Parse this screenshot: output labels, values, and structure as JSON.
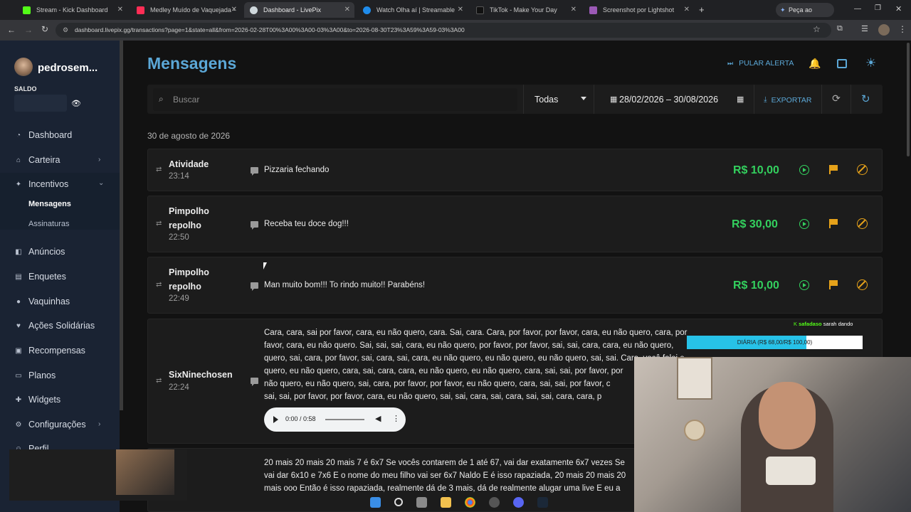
{
  "browser": {
    "tabs": [
      {
        "title": "Stream - Kick Dashboard",
        "color": "#53fc18"
      },
      {
        "title": "Medley Muído de Vaquejada - ",
        "color": "#ff2d55"
      },
      {
        "title": "Dashboard - LivePix",
        "color": "#cfd8dc"
      },
      {
        "title": "Watch Olha aí | Streamable",
        "color": "#1f8ceb"
      },
      {
        "title": "TikTok - Make Your Day",
        "color": "#111111"
      },
      {
        "title": "Screenshot por Lightshot",
        "color": "#9b59b6"
      }
    ],
    "new_tab": "+",
    "gemini": "Peça ao Gemini",
    "url": "dashboard.livepix.gg/transactions?page=1&state=all&from=2026-02-28T00%3A00%3A00-03%3A00&to=2026-08-30T23%3A59%3A59-03%3A00"
  },
  "sidebar": {
    "username": "pedrosem...",
    "saldo_label": "SALDO",
    "items": [
      {
        "label": "Dashboard",
        "icon": "speedometer-icon"
      },
      {
        "label": "Carteira",
        "icon": "bank-icon",
        "chevron": "›"
      },
      {
        "label": "Incentivos",
        "icon": "sparkle-icon",
        "chevron": "⌄"
      },
      {
        "label": "Anúncios",
        "icon": "megaphone-icon"
      },
      {
        "label": "Enquetes",
        "icon": "chart-icon"
      },
      {
        "label": "Vaquinhas",
        "icon": "piggy-icon"
      },
      {
        "label": "Ações Solidárias",
        "icon": "heart-hand-icon"
      },
      {
        "label": "Recompensas",
        "icon": "gift-icon"
      },
      {
        "label": "Planos",
        "icon": "credit-card-icon"
      },
      {
        "label": "Widgets",
        "icon": "puzzle-icon"
      },
      {
        "label": "Configurações",
        "icon": "gear-icon",
        "chevron": "›"
      },
      {
        "label": "Perfil",
        "icon": "user-icon"
      }
    ],
    "subitems": [
      "Mensagens",
      "Assinaturas"
    ]
  },
  "header": {
    "title": "Mensagens",
    "skip_alert": "PULAR ALERTA"
  },
  "filters": {
    "search_placeholder": "Buscar",
    "state": "Todas",
    "date_range": "28/02/2026 – 30/08/2026",
    "export": "EXPORTAR"
  },
  "date_header": "30 de agosto de 2026",
  "transactions": [
    {
      "name": "Atividade",
      "time": "23:14",
      "message": "Pizzaria fechando",
      "amount": "R$ 10,00"
    },
    {
      "name": "Pimpolho repolho",
      "time": "22:50",
      "message": "Receba teu doce dog!!!",
      "amount": "R$ 30,00"
    },
    {
      "name": "Pimpolho repolho",
      "time": "22:49",
      "message": "Man muito bom!!! To rindo muito!! Parabéns!",
      "amount": "R$ 10,00"
    },
    {
      "name": "SixNinechosen",
      "time": "22:24",
      "lines": [
        "Cara, cara, sai por favor, cara, eu não quero, cara. Sai, cara. Cara, por favor, por favor, cara, eu não quero, cara, por",
        "favor, cara, eu não quero. Sai, sai, sai, cara, eu não quero, por favor, por favor, sai, sai, cara, cara, eu não quero,",
        "quero, sai, cara, por favor, sai, cara, sai, cara, eu não quero, eu não quero, eu não quero, sai, sai. Cara, você falei e",
        "quero, eu não quero, cara, sai, cara, cara, eu não quero, eu não quero, cara, sai, sai, por favor, por",
        "não quero, eu não quero, sai, cara, por favor, por favor, eu não quero, cara, sai, sai, por favor, c",
        "sai, sai, por favor, por favor, cara, eu não quero, sai, sai, cara, sai, cara, sai, sai, cara, cara, p"
      ],
      "audio_time": "0:00 / 0:58"
    },
    {
      "name": "",
      "time": "",
      "lines": [
        "20 mais 20 mais 20 mais 7 é 6x7 Se vocês contarem de 1 até 67, vai dar exatamente 6x7 vezes Se",
        "vai dar 6x10 e 7x6 E o nome do meu filho vai ser 6x7 Naldo E é isso rapaziada, 20 mais 20 mais 20",
        "mais ooo Então é isso rapaziada, realmente dá de 3 mais, dá de realmente alugar uma live E eu a"
      ]
    }
  ],
  "overlay": {
    "goal_text": "DIÁRIA (R$ 68,00/R$ 100,00)",
    "goal_fraction": 0.68,
    "chat_user": "safadaso",
    "chat_text": "sarah dando"
  }
}
